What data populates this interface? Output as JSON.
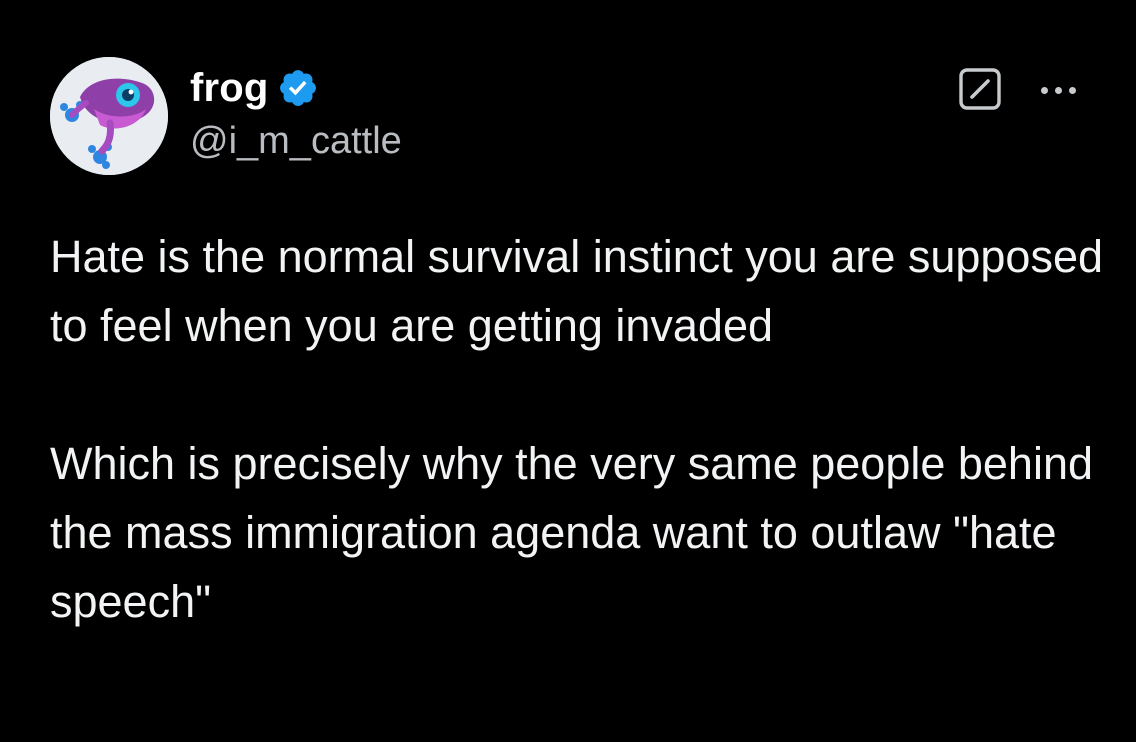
{
  "author": {
    "display_name": "frog",
    "handle": "@i_m_cattle",
    "verified": true,
    "avatar": "frog-avatar",
    "verified_color": "#1d9bf0"
  },
  "actions": {
    "grok_icon": "grok-icon",
    "more_icon": "more-horizontal-icon"
  },
  "post": {
    "paragraph_1": "Hate is the normal survival instinct you are supposed to feel when you are getting invaded",
    "paragraph_2": "Which is precisely why the very same people behind the mass immigration agenda want to outlaw \"hate speech\""
  },
  "colors": {
    "background": "#000000",
    "text": "#e7e9ea",
    "secondary_text": "#71767b"
  }
}
